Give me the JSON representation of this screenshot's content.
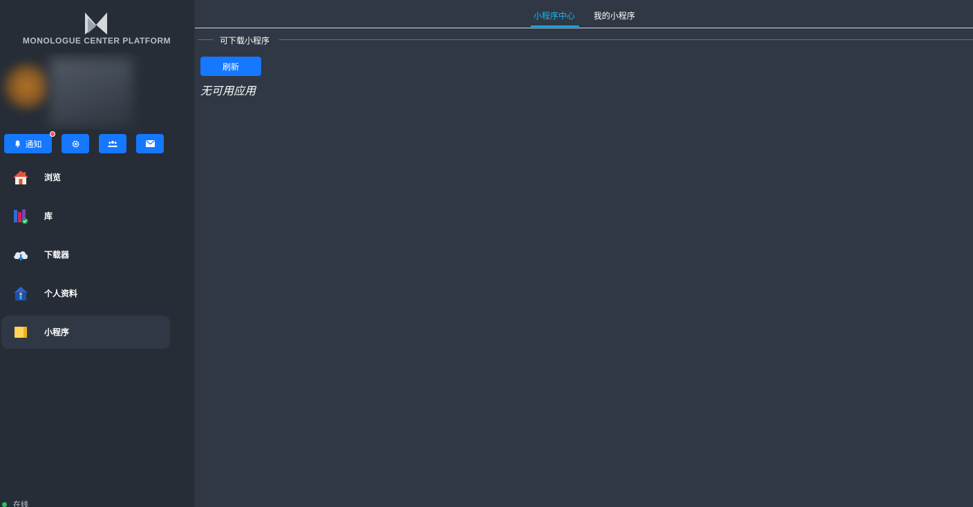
{
  "sidebar": {
    "brand_name": "MONOLOGUE CENTER PLATFORM",
    "quick_actions": {
      "notify_label": "通知",
      "settings_icon": "gear-icon",
      "friends_icon": "people-icon",
      "mail_icon": "mail-icon"
    },
    "nav_items": [
      {
        "label": "浏览",
        "icon": "home-icon"
      },
      {
        "label": "库",
        "icon": "library-icon"
      },
      {
        "label": "下载器",
        "icon": "cloud-download-icon"
      },
      {
        "label": "个人资料",
        "icon": "profile-house-icon"
      },
      {
        "label": "小程序",
        "icon": "mini-program-icon",
        "active": true
      }
    ],
    "status_label": "在线",
    "status_color": "#25c45a"
  },
  "main": {
    "tabs": [
      {
        "label": "小程序中心",
        "active": true
      },
      {
        "label": "我的小程序",
        "active": false
      }
    ],
    "section_title": "可下载小程序",
    "refresh_label": "刷新",
    "empty_message": "无可用应用"
  },
  "colors": {
    "accent": "#1677ff",
    "tab_active": "#1bb7f5",
    "sidebar_bg": "#262d36",
    "main_bg": "#2f3844"
  }
}
